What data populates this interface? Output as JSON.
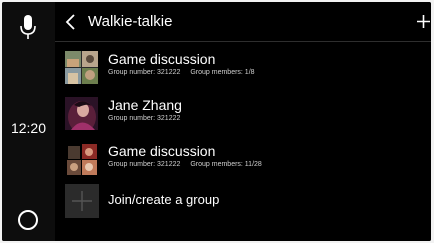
{
  "status_bar": {
    "time": "12:20",
    "mic_icon": "microphone-icon",
    "home_icon": "home-circle-icon"
  },
  "header": {
    "back_icon": "chevron-left-icon",
    "title": "Walkie-talkie",
    "add_icon": "plus-icon"
  },
  "groups": [
    {
      "name": "Game discussion",
      "number_text": "Group number: 321222",
      "members_text": "Group members: 1/8",
      "avatar": "group-avatar-collage"
    },
    {
      "name": "Jane Zhang",
      "number_text": "Group number: 321222",
      "avatar": "contact-avatar-photo"
    },
    {
      "name": "Game discussion",
      "number_text": "Group number: 321222",
      "members_text": "Group members: 11/28",
      "avatar": "group-avatar-collage"
    }
  ],
  "join": {
    "label": "Join/create a group",
    "icon": "plus-icon"
  },
  "colors": {
    "background": "#000000",
    "sidebar": "#0d0d0d",
    "text": "#ffffff",
    "subtext": "#cfcfcf",
    "tile": "#2b2b2b"
  }
}
